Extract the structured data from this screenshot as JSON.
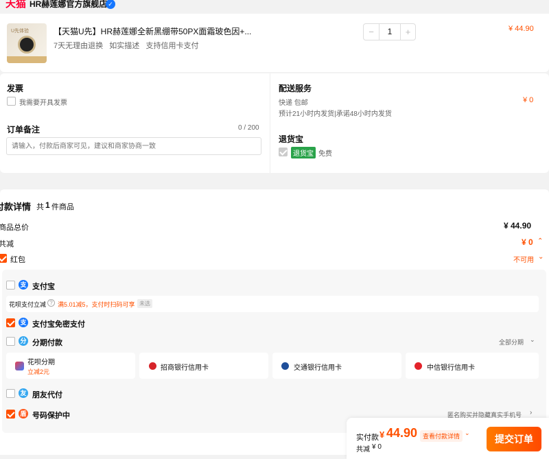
{
  "shop": {
    "brand": "天猫",
    "name": "HR赫莲娜官方旗舰店"
  },
  "item": {
    "title": "【天猫U先】HR赫莲娜全新黑绷带50PX面霜玻色因+...",
    "tags": "7天无理由退换   如实描述   支持信用卡支付",
    "qty": "1",
    "price": "¥ 44.90",
    "minus": "−",
    "plus": "+",
    "thumb_text": "U先体验"
  },
  "invoice": {
    "title": "发票",
    "option": "我需要开具发票"
  },
  "note": {
    "title": "订单备注",
    "count": "0 / 200",
    "placeholder": "请输入，付款后商家可见，建议和商家协商一致"
  },
  "delivery": {
    "title": "配送服务",
    "method": "快递 包邮",
    "eta": "预计21小时内发货|承诺48小时内发货",
    "price": "¥ 0"
  },
  "return": {
    "title": "退货宝",
    "tag": "退货宝",
    "free": "免费"
  },
  "detail": {
    "title": "付款详情",
    "count_pre": "共",
    "count": "1",
    "count_post": "件商品",
    "total_label": "商品总价",
    "total": "¥ 44.90",
    "discount_label": "共减",
    "discount": "¥ 0",
    "redpack": "红包",
    "redpack_status": "不可用"
  },
  "pay": {
    "alipay": "支付宝",
    "huabei_label": "花呗支付立减",
    "huabei_promo": "满5.01减5，支付时扫码可享",
    "huabei_tag": "未选",
    "alipay_free": "支付宝免密支付",
    "installment": "分期付款",
    "installment_all": "全部分期",
    "options": [
      {
        "name": "花呗分期",
        "sub": "立减2元"
      },
      {
        "name": "招商银行信用卡"
      },
      {
        "name": "交通银行信用卡"
      },
      {
        "name": "中信银行信用卡"
      }
    ],
    "friend": "朋友代付",
    "privacy": "号码保护中",
    "privacy_desc": "匿名购买并隐藏真实手机号"
  },
  "footer": {
    "label": "实付款",
    "yen": "¥",
    "amount": "44.90",
    "detail_link": "查看付款详情",
    "discount_label": "共减",
    "discount": "¥ 0",
    "submit": "提交订单"
  }
}
